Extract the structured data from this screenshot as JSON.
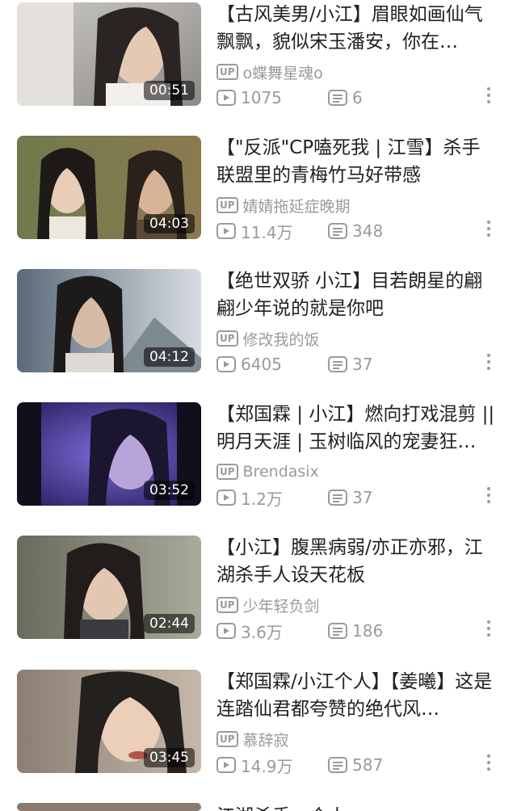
{
  "feed": {
    "items": [
      {
        "title": "【古风美男/小江】眉眼如画仙气飘飘，貌似宋玉潘安，你在…",
        "uploader": "o蝶舞星魂o",
        "duration": "00:51",
        "views": "1075",
        "danmaku": "6"
      },
      {
        "title": "【\"反派\"CP嗑死我 | 江雪】杀手联盟里的青梅竹马好带感",
        "uploader": "婧婧拖延症晚期",
        "duration": "04:03",
        "views": "11.4万",
        "danmaku": "348"
      },
      {
        "title": "【绝世双骄 小江】目若朗星的翩翩少年说的就是你吧",
        "uploader": "修改我的饭",
        "duration": "04:12",
        "views": "6405",
        "danmaku": "37"
      },
      {
        "title": "【郑国霖 | 小江】燃向打戏混剪 || 明月天涯 | 玉树临风的宠妻狂…",
        "uploader": "Brendasix",
        "duration": "03:52",
        "views": "1.2万",
        "danmaku": "37"
      },
      {
        "title": "【小江】腹黑病弱/亦正亦邪，江湖杀手人设天花板",
        "uploader": "少年轻负剑",
        "duration": "02:44",
        "views": "3.6万",
        "danmaku": "186"
      },
      {
        "title": "【郑国霖/小江个人】【姜曦】这是连踏仙君都夸赞的绝代风…",
        "uploader": "慕辞寂",
        "duration": "03:45",
        "views": "14.9万",
        "danmaku": "587"
      },
      {
        "title": "江湖杀手…个人…",
        "uploader": "",
        "duration": "",
        "views": "",
        "danmaku": ""
      }
    ],
    "up_badge": "UP"
  },
  "icons": {
    "play": "play-count-icon",
    "danmaku": "danmaku-count-icon",
    "more": "more-options-icon"
  }
}
